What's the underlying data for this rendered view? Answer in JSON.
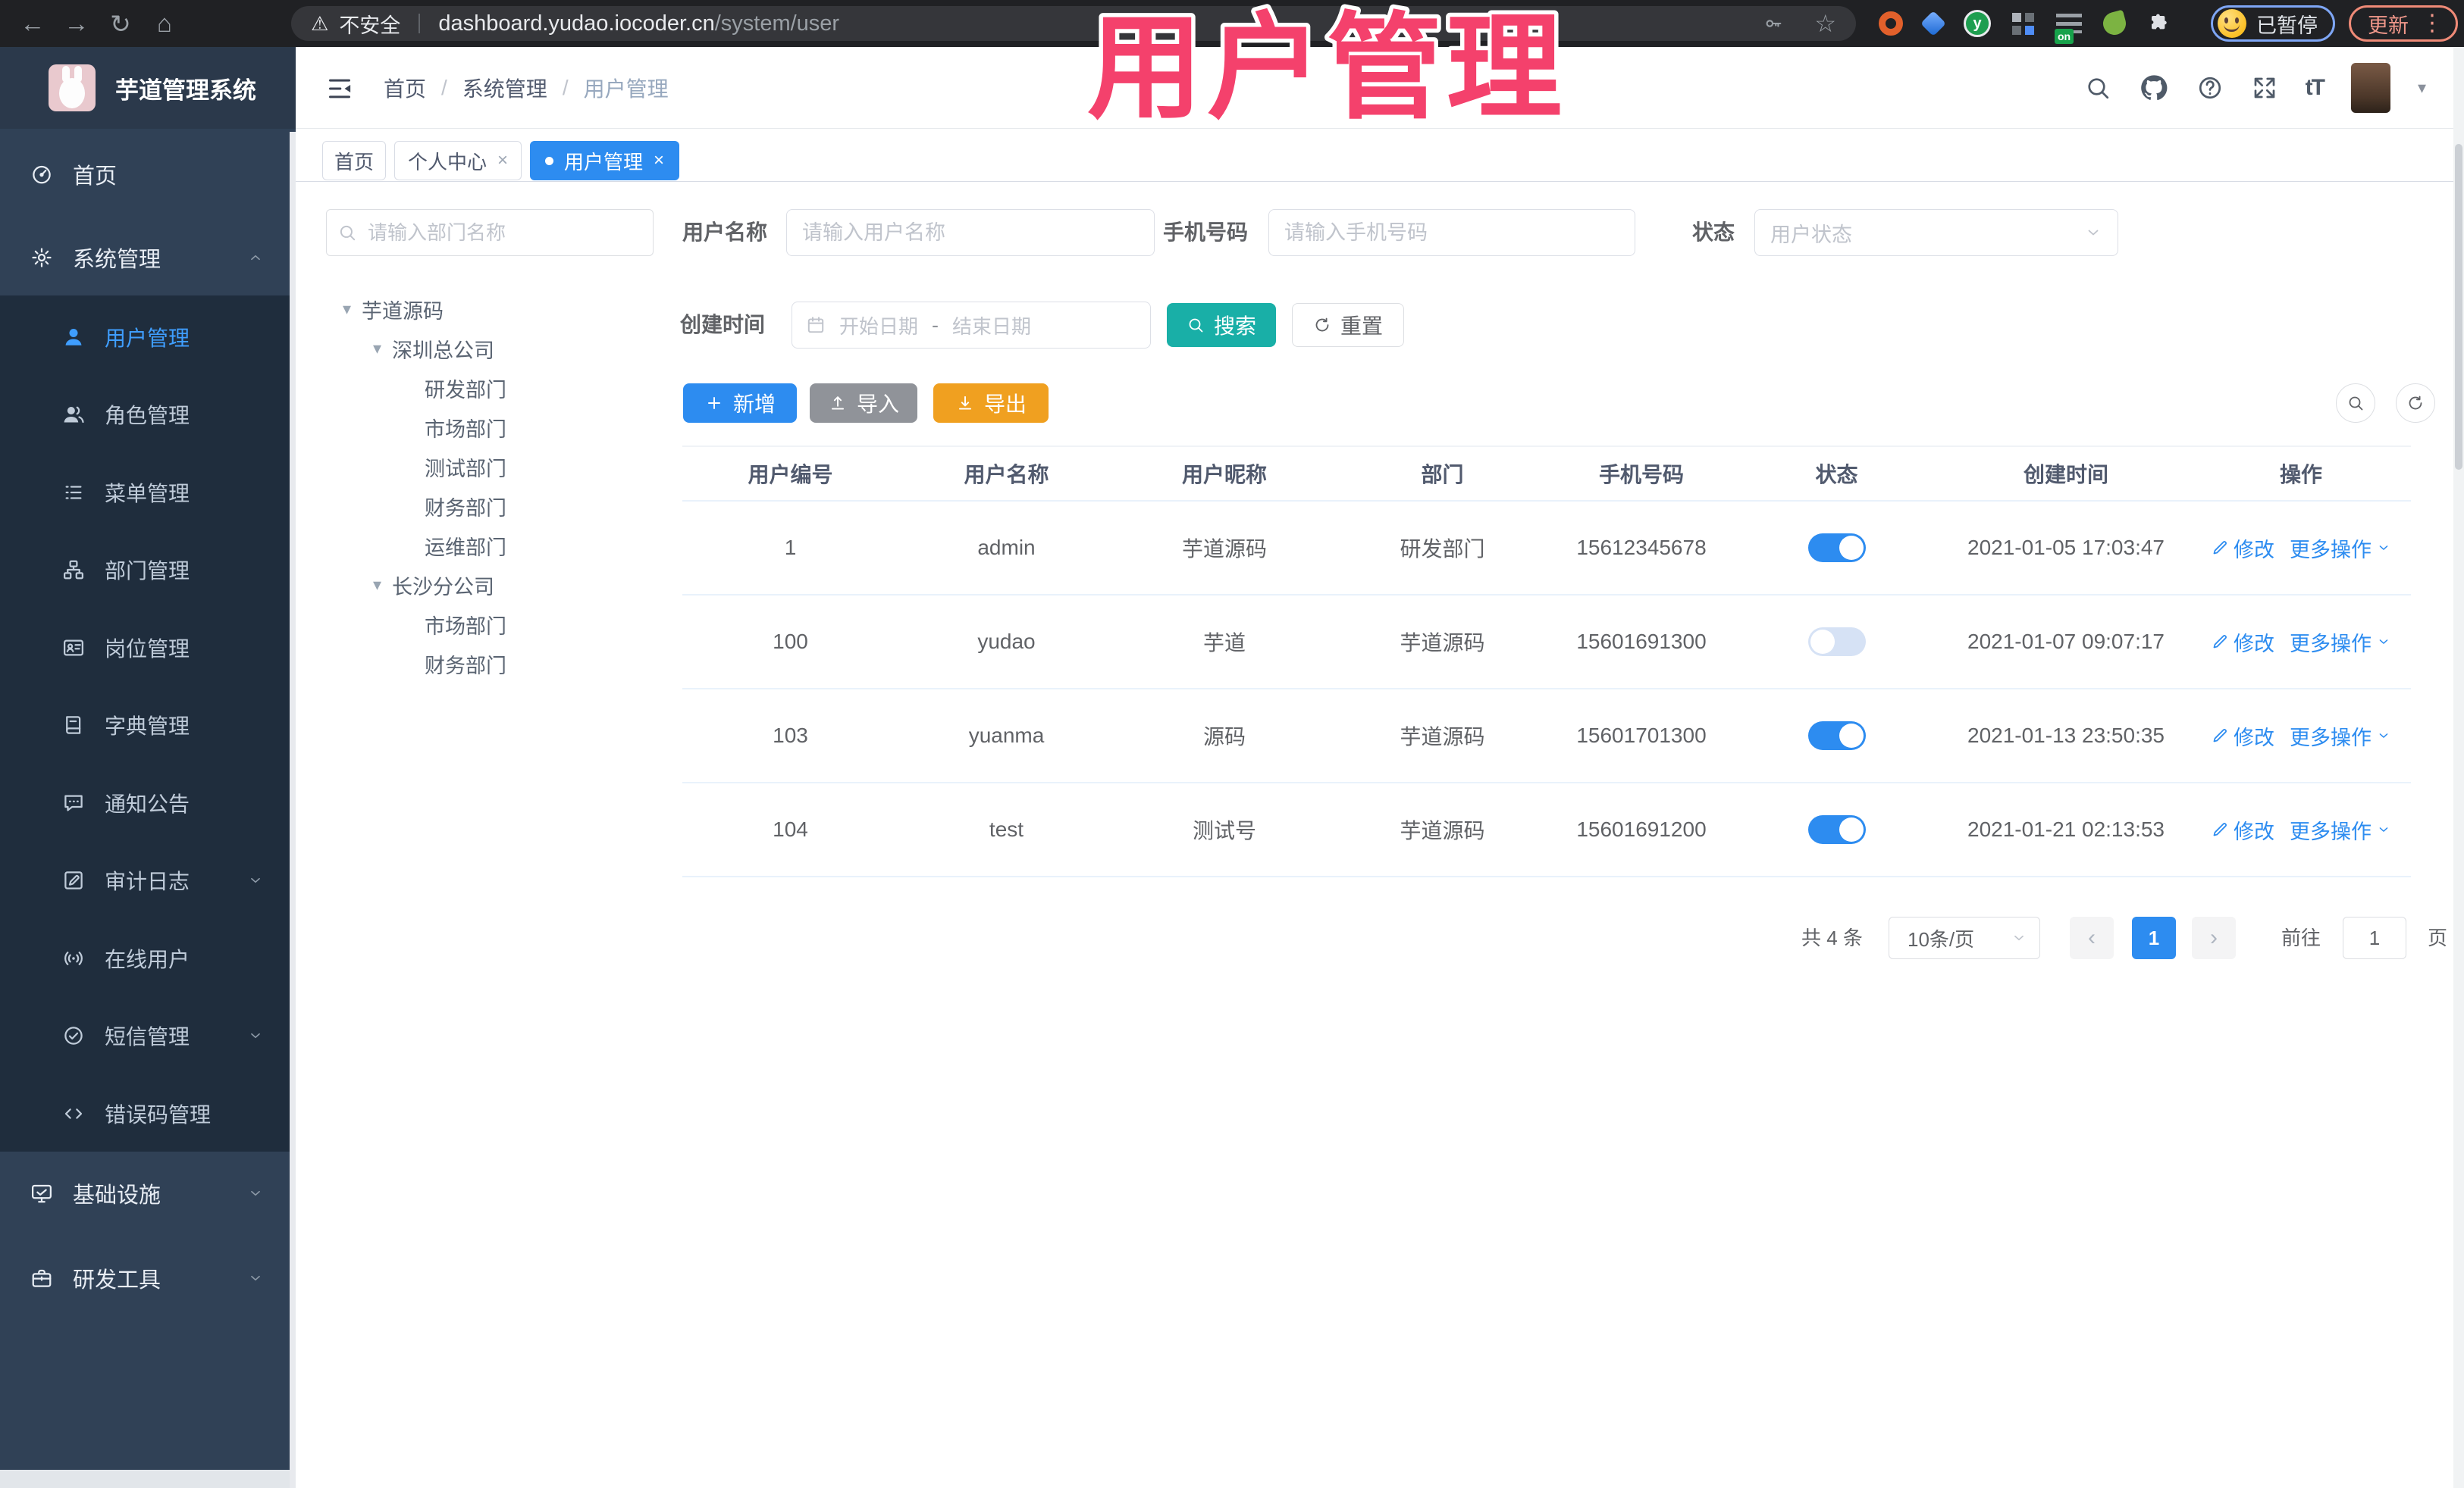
{
  "colors": {
    "accent": "#2D8CF0",
    "link_blue": "#2D8CF0",
    "teal": "#19AFA7",
    "amber": "#F0A020",
    "muted_gray": "#909399",
    "sidebar_bg": "#304156",
    "sidebar_submenu_bg": "#1F2D3D",
    "sidebar_active": "#3F9EFF",
    "toggle_off": "#D6E2F5",
    "annotation_pink": "#F4416C"
  },
  "icons": {
    "back": "←",
    "forward": "→",
    "reload": "↻",
    "home": "⌂",
    "warning": "⚠",
    "bookmark_star": "☆",
    "menu_kebab": "⋮",
    "breadcrumb_separator": "/",
    "tree_caret": "▾",
    "tab_close": "×",
    "page_prev": "‹",
    "page_next": "›",
    "font_size": "tT",
    "header_caret": "▾"
  },
  "browser": {
    "security_label": "不安全",
    "url_host": "dashboard.yudao.iocoder.cn",
    "url_path": "/system/user",
    "extension_on_badge": "on",
    "extension_letter": "y",
    "profile_status": "已暂停",
    "update_label": "更新"
  },
  "annotation": {
    "text": "用户管理"
  },
  "sidebar": {
    "logo_title": "芋道管理系统",
    "items": [
      {
        "label": "首页"
      },
      {
        "label": "系统管理"
      },
      {
        "label": "用户管理"
      },
      {
        "label": "角色管理"
      },
      {
        "label": "菜单管理"
      },
      {
        "label": "部门管理"
      },
      {
        "label": "岗位管理"
      },
      {
        "label": "字典管理"
      },
      {
        "label": "通知公告"
      },
      {
        "label": "审计日志"
      },
      {
        "label": "在线用户"
      },
      {
        "label": "短信管理"
      },
      {
        "label": "错误码管理"
      },
      {
        "label": "基础设施"
      },
      {
        "label": "研发工具"
      }
    ]
  },
  "header": {
    "breadcrumb": [
      "首页",
      "系统管理",
      "用户管理"
    ]
  },
  "tabs": [
    {
      "label": "首页"
    },
    {
      "label": "个人中心"
    },
    {
      "label": "用户管理"
    }
  ],
  "dept_panel": {
    "search_placeholder": "请输入部门名称",
    "tree": [
      {
        "label": "芋道源码"
      },
      {
        "label": "深圳总公司"
      },
      {
        "label": "研发部门"
      },
      {
        "label": "市场部门"
      },
      {
        "label": "测试部门"
      },
      {
        "label": "财务部门"
      },
      {
        "label": "运维部门"
      },
      {
        "label": "长沙分公司"
      },
      {
        "label": "市场部门"
      },
      {
        "label": "财务部门"
      }
    ]
  },
  "filters": {
    "username_label": "用户名称",
    "username_placeholder": "请输入用户名称",
    "mobile_label": "手机号码",
    "mobile_placeholder": "请输入手机号码",
    "status_label": "状态",
    "status_placeholder": "用户状态",
    "create_time_label": "创建时间",
    "date_start_placeholder": "开始日期",
    "date_separator": "-",
    "date_end_placeholder": "结束日期",
    "search_label": "搜索",
    "reset_label": "重置"
  },
  "toolbar": {
    "add_label": "新增",
    "import_label": "导入",
    "export_label": "导出"
  },
  "table": {
    "columns": [
      "用户编号",
      "用户名称",
      "用户昵称",
      "部门",
      "手机号码",
      "状态",
      "创建时间",
      "操作"
    ],
    "rows": [
      {
        "id": "1",
        "username": "admin",
        "nickname": "芋道源码",
        "dept": "研发部门",
        "mobile": "15612345678",
        "status": "on",
        "created": "2021-01-05 17:03:47"
      },
      {
        "id": "100",
        "username": "yudao",
        "nickname": "芋道",
        "dept": "芋道源码",
        "mobile": "15601691300",
        "status": "off",
        "created": "2021-01-07 09:07:17"
      },
      {
        "id": "103",
        "username": "yuanma",
        "nickname": "源码",
        "dept": "芋道源码",
        "mobile": "15601701300",
        "status": "on",
        "created": "2021-01-13 23:50:35"
      },
      {
        "id": "104",
        "username": "test",
        "nickname": "测试号",
        "dept": "芋道源码",
        "mobile": "15601691200",
        "status": "on",
        "created": "2021-01-21 02:13:53"
      }
    ],
    "actions": {
      "edit": "修改",
      "more": "更多操作"
    }
  },
  "pagination": {
    "total": "共 4 条",
    "page_size": "10条/页",
    "page": "1",
    "goto": "前往",
    "goto_value": "1",
    "unit": "页"
  }
}
